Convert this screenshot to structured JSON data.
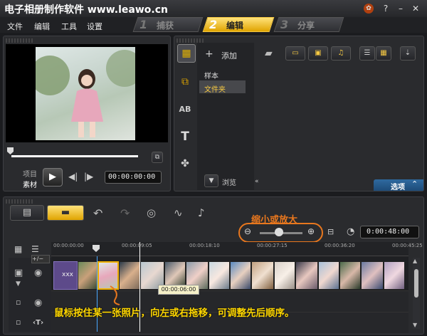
{
  "app": {
    "title": "电子相册制作软件 www.leawo.cn"
  },
  "menu": {
    "file": "文件",
    "edit": "编辑",
    "tools": "工具",
    "settings": "设置"
  },
  "steps": [
    {
      "num": "1",
      "label": "捕获"
    },
    {
      "num": "2",
      "label": "编辑"
    },
    {
      "num": "3",
      "label": "分享"
    }
  ],
  "player": {
    "mode_project": "项目",
    "mode_clip": "素材",
    "timecode": "00:00:00:00"
  },
  "library": {
    "add_label": "添加",
    "folders": [
      "样本",
      "文件夹"
    ],
    "browse_label": "浏览",
    "options_label": "选项"
  },
  "timeline": {
    "zoom_label": "缩小或放大",
    "duration": "0:00:48:00",
    "ruler": [
      "00:00:00:00",
      "00:00:09:05",
      "00:00:18:10",
      "00:00:27:15",
      "00:00:36:20",
      "00:00:45:25"
    ],
    "tooltip": "00:00:06:00",
    "clip_text": "xxx",
    "hint": "鼠标按住某一张照片，向左或右拖移，可调整先后顺序。"
  },
  "colors": {
    "accent": "#f5c842",
    "annotation": "#e8771e",
    "hint_text": "#ffd700"
  }
}
